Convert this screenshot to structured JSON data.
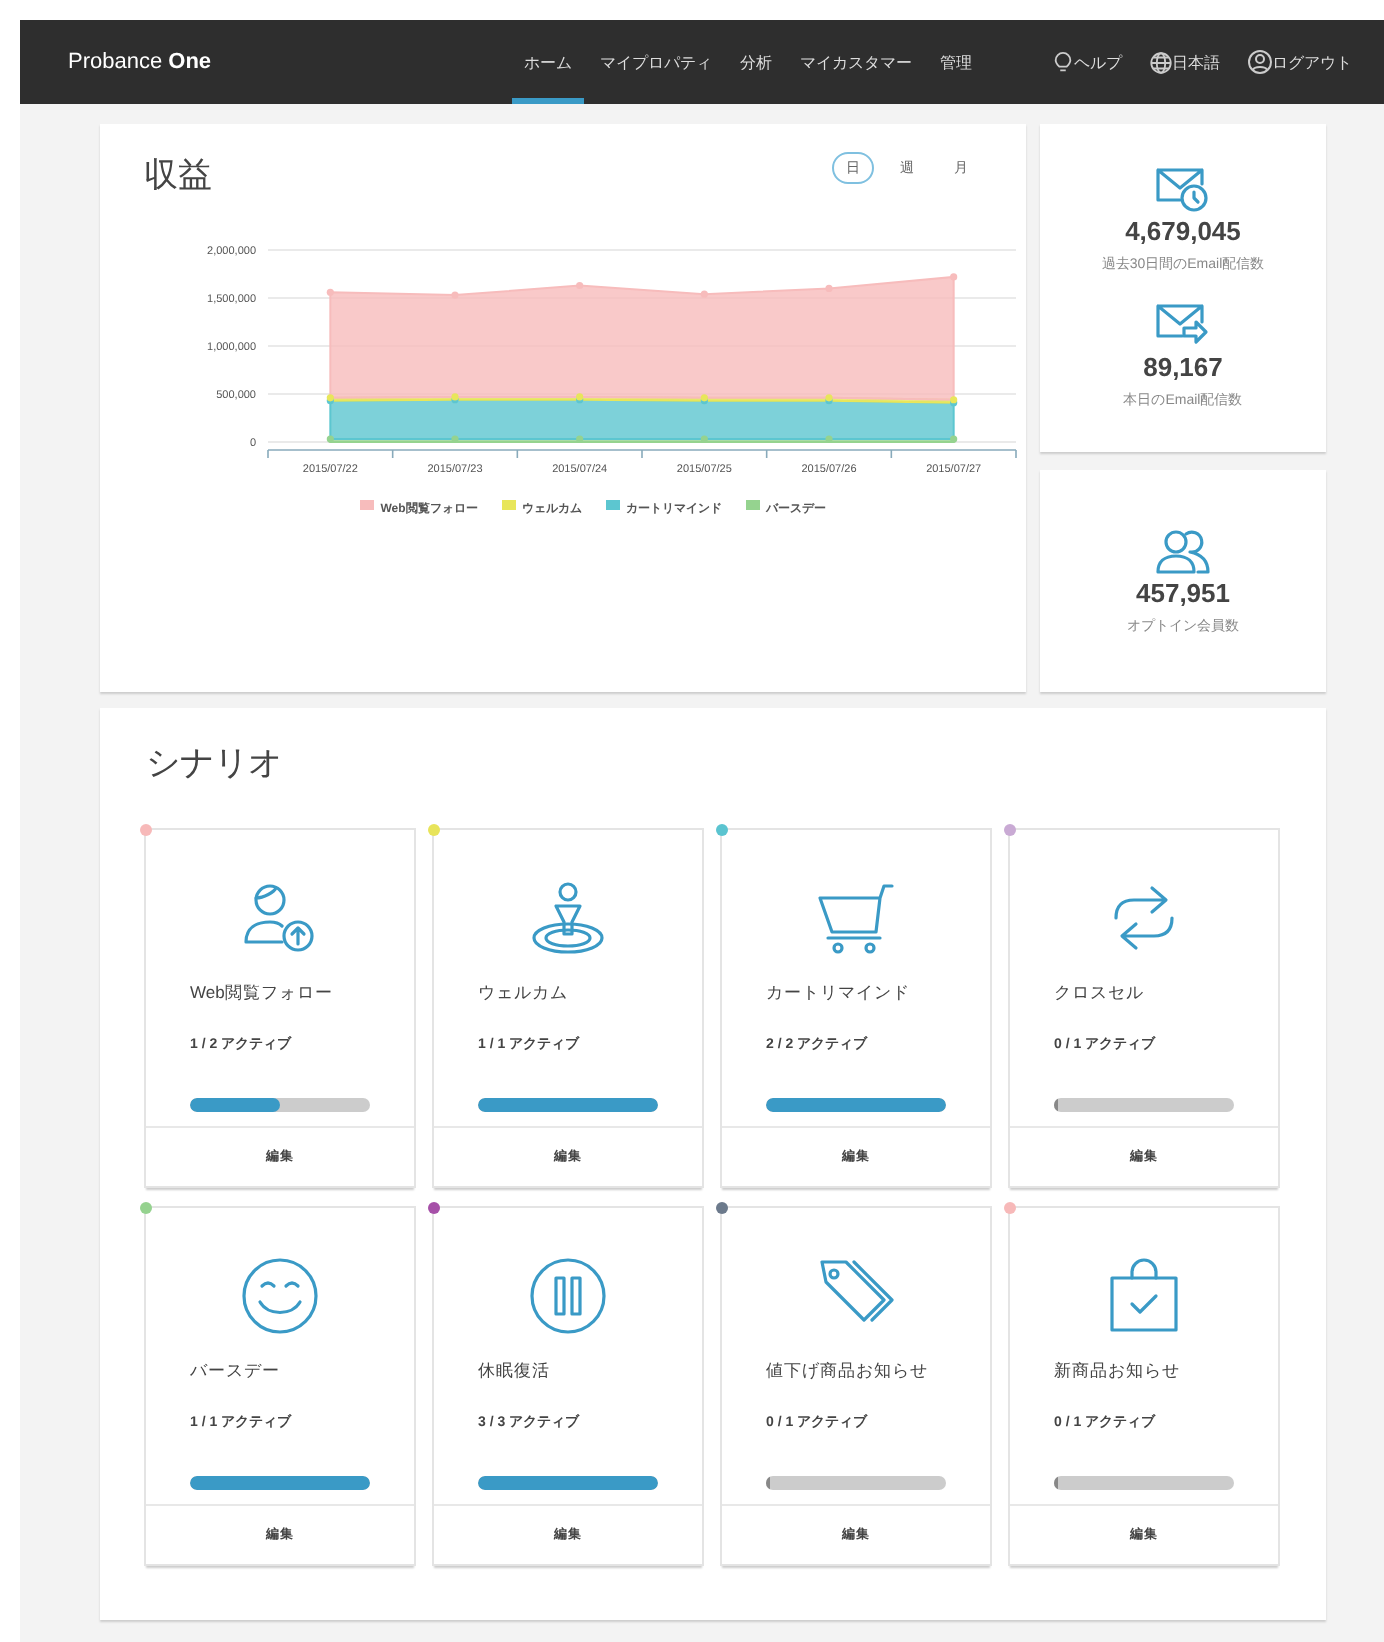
{
  "header": {
    "logo": "Probance **One**",
    "nav": [
      {
        "label": "ホーム",
        "selected": true
      },
      {
        "label": "マイプロパティ",
        "selected": false
      },
      {
        "label": "分析",
        "selected": false
      },
      {
        "label": "マイカスタマー",
        "selected": false
      },
      {
        "label": "管理",
        "selected": false
      }
    ],
    "utility": [
      {
        "kind": "help",
        "label": "ヘルプ"
      },
      {
        "kind": "language",
        "label": "日本語"
      },
      {
        "kind": "logout",
        "label": "ログアウト"
      }
    ]
  },
  "revenue": {
    "title": "収益",
    "periods": [
      {
        "label": "日",
        "selected": true
      },
      {
        "label": "週",
        "selected": false
      },
      {
        "label": "月",
        "selected": false
      }
    ],
    "chart_data": {
      "type": "area",
      "stacked": true,
      "grid": true,
      "categories": [
        "2015/07/22",
        "2015/07/23",
        "2015/07/24",
        "2015/07/25",
        "2015/07/26",
        "2015/07/27"
      ],
      "ylim": [
        0,
        2000000
      ],
      "yticks": [
        {
          "value": 0,
          "label": "0"
        },
        {
          "value": 500000,
          "label": "500,000"
        },
        {
          "value": 1000000,
          "label": "1,000,000"
        },
        {
          "value": 1500000,
          "label": "1,500,000"
        },
        {
          "value": 2000000,
          "label": "2,000,000"
        }
      ],
      "series": [
        {
          "name": "バースデー",
          "color": "#95d38f",
          "values": [
            30000,
            30000,
            30000,
            30000,
            30000,
            30000
          ]
        },
        {
          "name": "カートリマインド",
          "color": "#5cc6d0",
          "values": [
            400000,
            410000,
            410000,
            400000,
            400000,
            380000
          ]
        },
        {
          "name": "ウェルカム",
          "color": "#e8e65a",
          "values": [
            30000,
            30000,
            30000,
            30000,
            30000,
            30000
          ]
        },
        {
          "name": "Web閲覧フォロー",
          "color": "#f7bcbc",
          "values": [
            1100000,
            1060000,
            1160000,
            1080000,
            1140000,
            1280000
          ]
        }
      ]
    }
  },
  "stats": [
    {
      "kind": "mail-clock",
      "value": "4,679,045",
      "label": "過去30日間のEmail配信数"
    },
    {
      "kind": "mail-send",
      "value": "89,167",
      "label": "本日のEmail配信数"
    },
    {
      "kind": "users",
      "value": "457,951",
      "label": "オプトイン会員数"
    }
  ],
  "scenarios": {
    "title": "シナリオ",
    "cards": [
      {
        "kind": "user-up",
        "color": "#f7b9b9",
        "name": "Web閲覧フォロー",
        "status": "1 / 2 アクティブ",
        "level": 0.5,
        "action": "編集"
      },
      {
        "kind": "target",
        "color": "#e8e45a",
        "name": "ウェルカム",
        "status": "1 / 1 アクティブ",
        "level": 1,
        "action": "編集"
      },
      {
        "kind": "cart",
        "color": "#5bc4d0",
        "name": "カートリマインド",
        "status": "2 / 2 アクティブ",
        "level": 1,
        "action": "編集"
      },
      {
        "kind": "swap",
        "color": "#c9aad4",
        "name": "クロスセル",
        "status": "0 / 1 アクティブ",
        "level": 0,
        "action": "編集"
      },
      {
        "kind": "smile",
        "color": "#95d28f",
        "name": "バースデー",
        "status": "1 / 1 アクティブ",
        "level": 1,
        "action": "編集"
      },
      {
        "kind": "pause",
        "color": "#a650a8",
        "name": "休眠復活",
        "status": "3 / 3 アクティブ",
        "level": 1,
        "action": "編集"
      },
      {
        "kind": "tag",
        "color": "#6c7a8c",
        "name": "値下げ商品お知らせ",
        "status": "0 / 1 アクティブ",
        "level": 0,
        "action": "編集"
      },
      {
        "kind": "bag",
        "color": "#f7b9b9",
        "name": "新商品お知らせ",
        "status": "0 / 1 アクティブ",
        "level": 0,
        "action": "編集"
      }
    ]
  }
}
